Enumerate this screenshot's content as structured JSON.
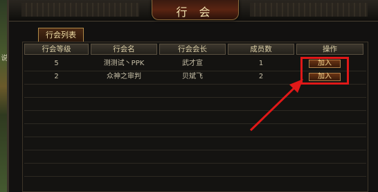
{
  "window": {
    "title": "行 会"
  },
  "tab": {
    "label": "行会列表"
  },
  "side": {
    "text": "说"
  },
  "table": {
    "columns": [
      "行会等级",
      "行会名",
      "行会会长",
      "成员数",
      "操作"
    ],
    "rows": [
      {
        "level": "5",
        "name": "测测试丶PPK",
        "leader": "武才宣",
        "members": "1",
        "action": "加入"
      },
      {
        "level": "2",
        "name": "众神之审判",
        "leader": "贝斌飞",
        "members": "2",
        "action": "加入"
      }
    ]
  },
  "annotation": {
    "color": "#e01818"
  }
}
